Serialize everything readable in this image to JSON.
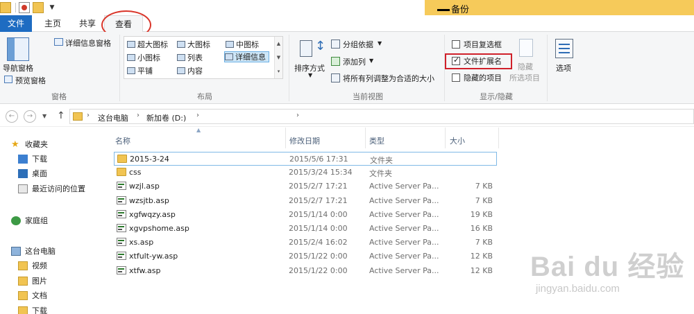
{
  "window": {
    "title": "备份"
  },
  "ribbon_tabs": {
    "file": "文件",
    "home": "主页",
    "share": "共享",
    "view": "查看"
  },
  "panes_group": {
    "label": "窗格",
    "nav_pane": "导航窗格",
    "preview_pane": "预览窗格",
    "details_pane": "详细信息窗格"
  },
  "layout_group": {
    "label": "布局",
    "items": [
      "超大图标",
      "大图标",
      "中图标",
      "小图标",
      "列表",
      "详细信息",
      "平铺",
      "内容"
    ],
    "selected": "详细信息"
  },
  "current_view_group": {
    "label": "当前视图",
    "sort_by": "排序方式",
    "group_by": "分组依据",
    "add_columns": "添加列",
    "size_all_columns": "将所有列调整为合适的大小"
  },
  "show_hide_group": {
    "label": "显示/隐藏",
    "item_checkboxes": "项目复选框",
    "file_name_extensions": "文件扩展名",
    "hidden_items": "隐藏的项目",
    "hide_selected_1": "隐藏",
    "hide_selected_2": "所选项目",
    "item_checkboxes_checked": false,
    "file_name_extensions_checked": true,
    "hidden_items_checked": false
  },
  "options": {
    "label": "选项"
  },
  "address": {
    "crumbs": [
      "这台电脑",
      "新加卷 (D:)"
    ]
  },
  "nav_pane": {
    "favorites": "收藏夹",
    "downloads": "下载",
    "desktop": "桌面",
    "recent": "最近访问的位置",
    "homegroup": "家庭组",
    "this_pc": "这台电脑",
    "videos": "视频",
    "pictures": "图片",
    "documents": "文档",
    "downloads2": "下载"
  },
  "columns": {
    "name": "名称",
    "date": "修改日期",
    "type": "类型",
    "size": "大小"
  },
  "files": [
    {
      "name": "2015-3-24",
      "date": "2015/5/6 17:31",
      "type": "文件夹",
      "size": "",
      "kind": "folder"
    },
    {
      "name": "css",
      "date": "2015/3/24 15:34",
      "type": "文件夹",
      "size": "",
      "kind": "folder"
    },
    {
      "name": "wzjl.asp",
      "date": "2015/2/7 17:21",
      "type": "Active Server Pa...",
      "size": "7 KB",
      "kind": "asp"
    },
    {
      "name": "wzsjtb.asp",
      "date": "2015/2/7 17:21",
      "type": "Active Server Pa...",
      "size": "7 KB",
      "kind": "asp"
    },
    {
      "name": "xgfwqzy.asp",
      "date": "2015/1/14 0:00",
      "type": "Active Server Pa...",
      "size": "19 KB",
      "kind": "asp"
    },
    {
      "name": "xgvpshome.asp",
      "date": "2015/1/14 0:00",
      "type": "Active Server Pa...",
      "size": "16 KB",
      "kind": "asp"
    },
    {
      "name": "xs.asp",
      "date": "2015/2/4 16:02",
      "type": "Active Server Pa...",
      "size": "7 KB",
      "kind": "asp"
    },
    {
      "name": "xtfult-yw.asp",
      "date": "2015/1/22 0:00",
      "type": "Active Server Pa...",
      "size": "12 KB",
      "kind": "asp"
    },
    {
      "name": "xtfw.asp",
      "date": "2015/1/22 0:00",
      "type": "Active Server Pa...",
      "size": "12 KB",
      "kind": "asp"
    }
  ],
  "watermark": {
    "main": "Bai du 经验",
    "sub": "jingyan.baidu.com"
  }
}
